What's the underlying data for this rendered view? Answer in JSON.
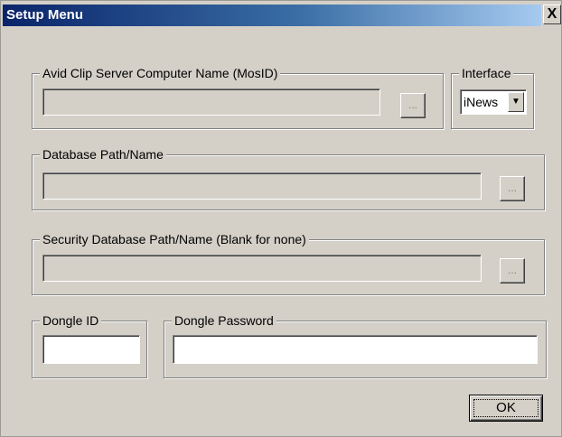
{
  "window": {
    "title": "Setup Menu",
    "close_glyph": "X"
  },
  "groups": {
    "clip_server": {
      "legend": "Avid Clip Server Computer Name (MosID)",
      "value": "",
      "browse_label": "..."
    },
    "interface": {
      "legend": "Interface",
      "selected": "iNews",
      "arrow_glyph": "▼"
    },
    "database": {
      "legend": "Database Path/Name",
      "value": "",
      "browse_label": "..."
    },
    "security_database": {
      "legend": "Security Database Path/Name (Blank for none)",
      "value": "",
      "browse_label": "..."
    },
    "dongle_id": {
      "legend": "Dongle ID",
      "value": ""
    },
    "dongle_password": {
      "legend": "Dongle Password",
      "value": ""
    }
  },
  "buttons": {
    "ok_label": "OK"
  }
}
